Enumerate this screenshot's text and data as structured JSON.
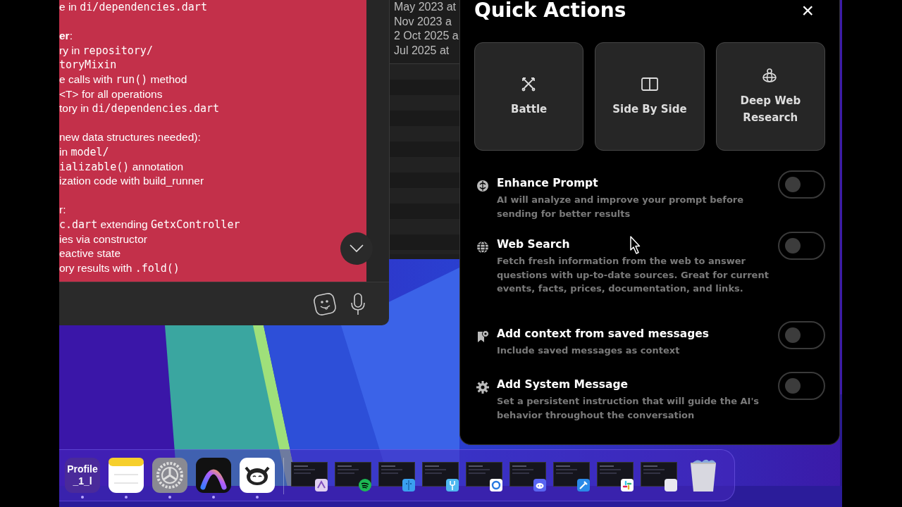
{
  "chat": {
    "lines": [
      {
        "space_before": false,
        "segments": [
          {
            "kind": "text",
            "text": "e in "
          },
          {
            "kind": "code",
            "text": "di/dependencies.dart"
          }
        ]
      },
      {
        "space_before": true,
        "segments": [
          {
            "kind": "bold",
            "text": "er"
          },
          {
            "kind": "text",
            "text": ":"
          }
        ]
      },
      {
        "space_before": false,
        "segments": [
          {
            "kind": "text",
            "text": "ry in "
          },
          {
            "kind": "code",
            "text": "repository/"
          }
        ]
      },
      {
        "space_before": false,
        "segments": [
          {
            "kind": "code",
            "text": "toryMixin"
          }
        ]
      },
      {
        "space_before": false,
        "segments": [
          {
            "kind": "text",
            "text": "e calls with "
          },
          {
            "kind": "code",
            "text": "run()"
          },
          {
            "kind": "text",
            "text": " method"
          }
        ]
      },
      {
        "space_before": false,
        "segments": [
          {
            "kind": "text",
            "text": "<T> for all operations"
          }
        ]
      },
      {
        "space_before": false,
        "segments": [
          {
            "kind": "text",
            "text": "tory in "
          },
          {
            "kind": "code",
            "text": "di/dependencies.dart"
          }
        ]
      },
      {
        "space_before": true,
        "segments": [
          {
            "kind": "text",
            "text": "new data structures needed):"
          }
        ]
      },
      {
        "space_before": false,
        "segments": [
          {
            "kind": "text",
            "text": "in "
          },
          {
            "kind": "code",
            "text": "model/"
          }
        ]
      },
      {
        "space_before": false,
        "segments": [
          {
            "kind": "code",
            "text": "ializable()"
          },
          {
            "kind": "text",
            "text": " annotation"
          }
        ]
      },
      {
        "space_before": false,
        "segments": [
          {
            "kind": "text",
            "text": "ization code with build_runner"
          }
        ]
      },
      {
        "space_before": true,
        "segments": [
          {
            "kind": "text",
            "text": "r:"
          }
        ]
      },
      {
        "space_before": false,
        "segments": [
          {
            "kind": "code",
            "text": "c.dart"
          },
          {
            "kind": "text",
            "text": " extending "
          },
          {
            "kind": "code",
            "text": "GetxController"
          }
        ]
      },
      {
        "space_before": false,
        "segments": [
          {
            "kind": "text",
            "text": "ies via constructor"
          }
        ]
      },
      {
        "space_before": false,
        "segments": [
          {
            "kind": "text",
            "text": "eactive state"
          }
        ]
      },
      {
        "space_before": false,
        "segments": [
          {
            "kind": "text",
            "text": "ory results with "
          },
          {
            "kind": "code",
            "text": ".fold()"
          }
        ]
      }
    ]
  },
  "date_list": {
    "items": [
      "May 2023 at",
      "Nov 2023 a",
      "2 Oct 2025 a",
      "Jul 2025 at"
    ]
  },
  "quick_actions": {
    "title": "Quick Actions",
    "close": "×",
    "cards": [
      {
        "label": "Battle"
      },
      {
        "label": "Side By Side"
      },
      {
        "label": "Deep Web Research"
      }
    ],
    "options": [
      {
        "title": "Enhance Prompt",
        "description": "AI will analyze and improve your prompt before sending for better results",
        "on": false
      },
      {
        "title": "Web Search",
        "description": "Fetch fresh information from the web to answer questions with up-to-date sources. Great for current events, facts, prices, documentation, and links.",
        "on": false
      },
      {
        "title": "Add context from saved messages",
        "description": "Include saved messages as context",
        "on": false
      },
      {
        "title": "Add System Message",
        "description": "Set a persistent instruction that will guide the AI's behavior throughout the conversation",
        "on": false
      }
    ]
  },
  "dock": {
    "items": [
      {
        "kind": "label-tile",
        "label": "Profile_1_l",
        "running": true
      },
      {
        "kind": "app",
        "running": true
      },
      {
        "kind": "app",
        "running": true
      },
      {
        "kind": "app",
        "running": true
      },
      {
        "kind": "app",
        "running": true
      },
      {
        "kind": "divider"
      },
      {
        "kind": "window",
        "running": false
      },
      {
        "kind": "window",
        "running": false
      },
      {
        "kind": "window",
        "running": false
      },
      {
        "kind": "window",
        "running": false
      },
      {
        "kind": "window",
        "running": false
      },
      {
        "kind": "window",
        "running": false
      },
      {
        "kind": "window",
        "running": false
      },
      {
        "kind": "window",
        "running": false
      },
      {
        "kind": "window",
        "running": false
      },
      {
        "kind": "trash",
        "running": false
      }
    ]
  }
}
